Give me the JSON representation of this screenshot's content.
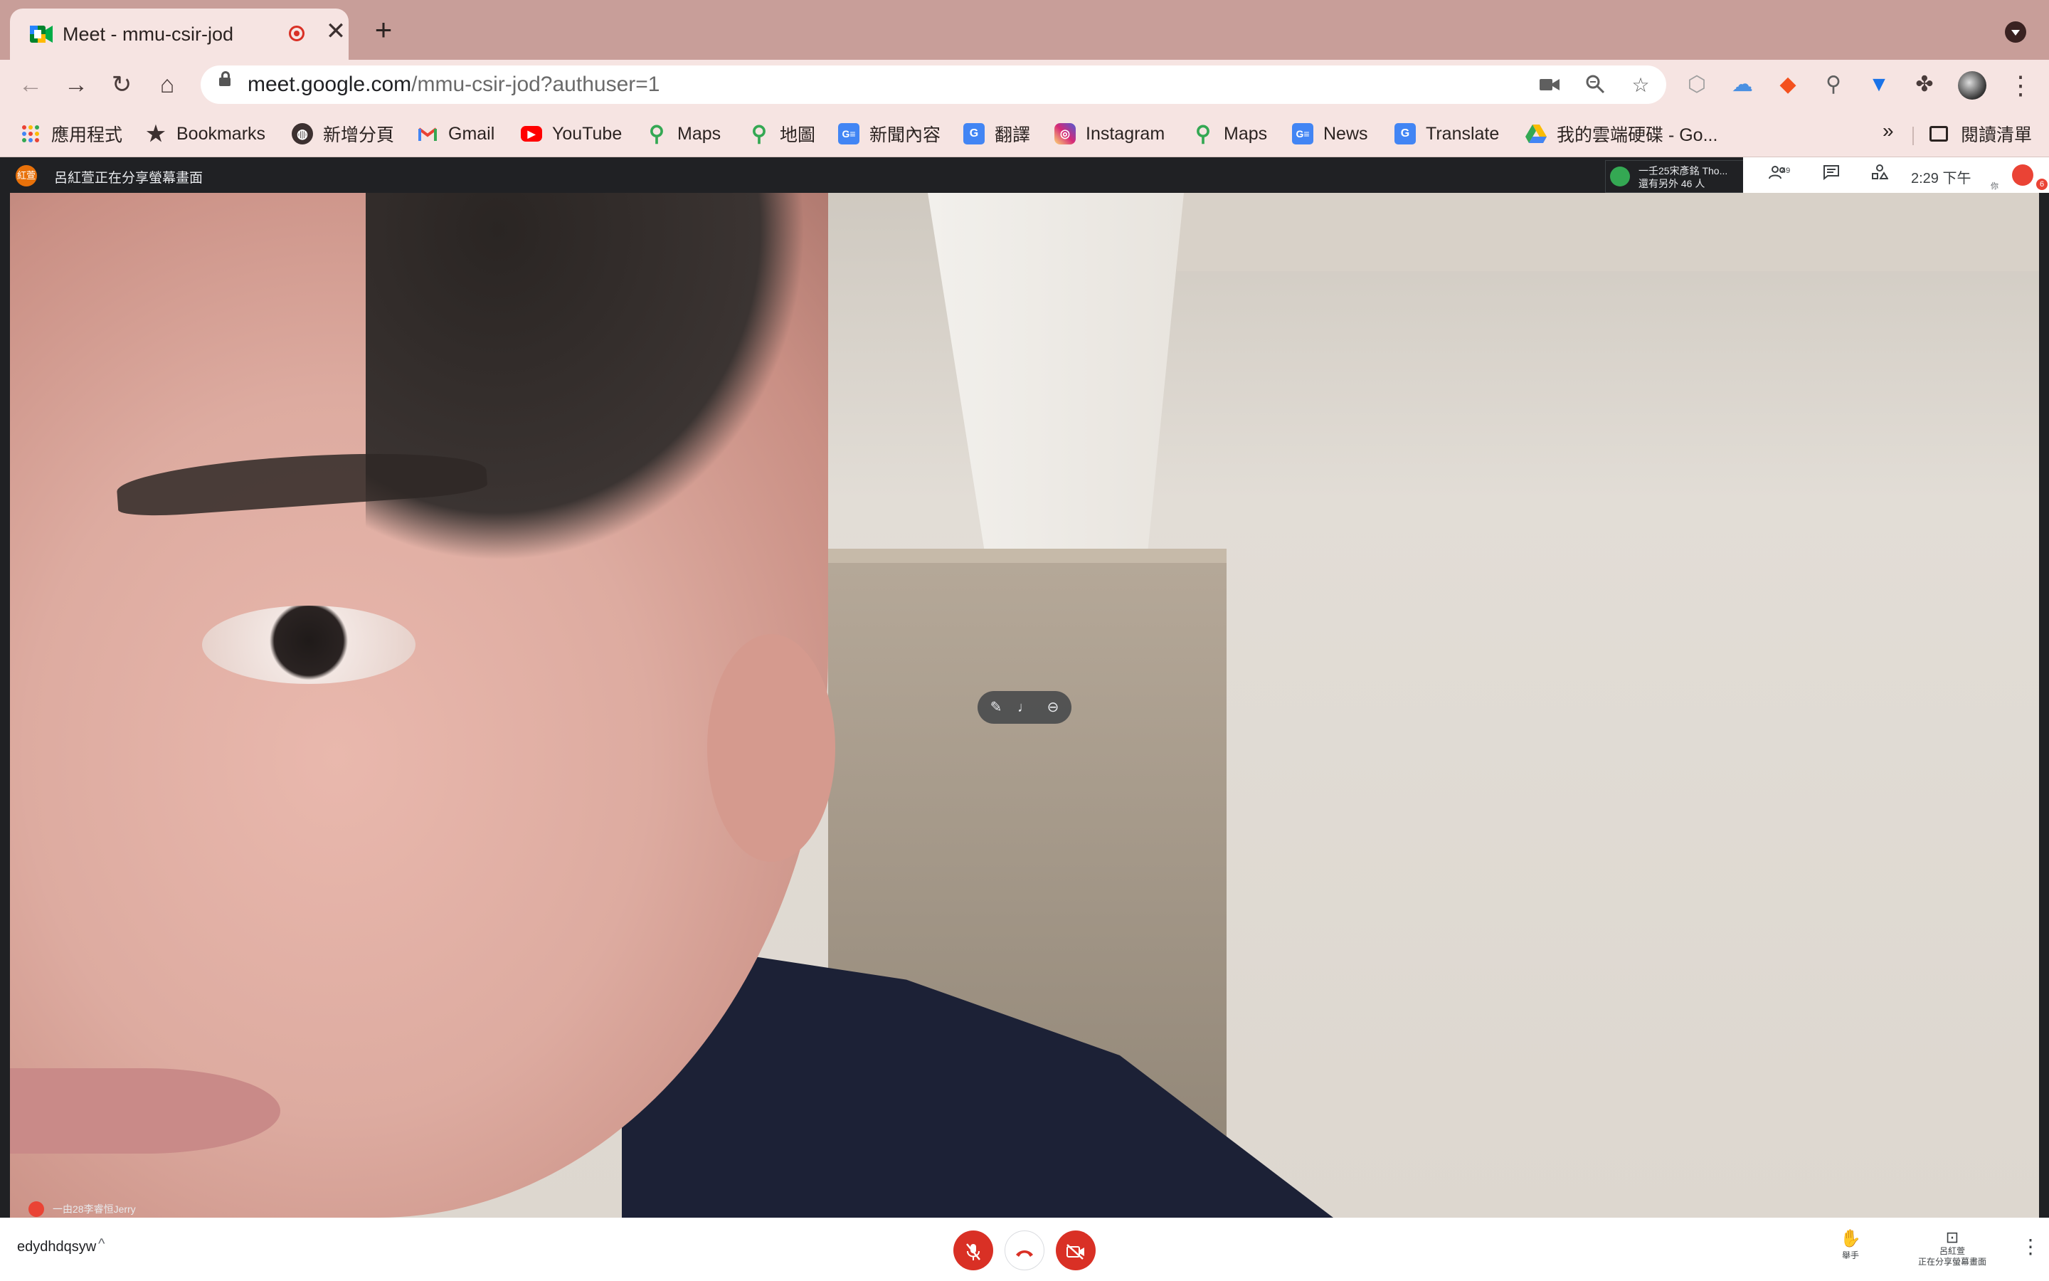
{
  "tab": {
    "title": "Meet - mmu-csir-jod",
    "close": "✕",
    "new_tab": "+"
  },
  "toolbar": {
    "back": "←",
    "forward": "→",
    "reload": "↻",
    "home": "⌂",
    "url_host": "meet.google.com",
    "url_path": "/mmu-csir-jod?authuser=1",
    "menu": "⋮"
  },
  "bookmarks": {
    "items": [
      {
        "label": "應用程式",
        "icon": "apps-grid-icon"
      },
      {
        "label": "Bookmarks",
        "icon": "star-icon"
      },
      {
        "label": "新增分頁",
        "icon": "globe-icon"
      },
      {
        "label": "Gmail",
        "icon": "gmail-icon"
      },
      {
        "label": "YouTube",
        "icon": "youtube-icon"
      },
      {
        "label": "Maps",
        "icon": "maps-pin-icon"
      },
      {
        "label": "地圖",
        "icon": "maps-pin-icon"
      },
      {
        "label": "新聞內容",
        "icon": "google-news-icon"
      },
      {
        "label": "翻譯",
        "icon": "translate-icon"
      },
      {
        "label": "Instagram",
        "icon": "instagram-icon"
      },
      {
        "label": "Maps",
        "icon": "maps-pin-icon"
      },
      {
        "label": "News",
        "icon": "google-news-icon"
      },
      {
        "label": "Translate",
        "icon": "translate-icon"
      },
      {
        "label": "我的雲端硬碟 - Go...",
        "icon": "google-drive-icon"
      }
    ],
    "more": "»",
    "reading_list": "閱讀清單"
  },
  "meet": {
    "presenter_avatar": "紅萱",
    "sharing_text": "呂紅萱正在分享螢幕畫面",
    "participant_chip_line1": "一壬25宋彥銘 Tho...",
    "participant_chip_line2": "還有另外 46 人",
    "participant_count": "49",
    "clock": "2:29 下午",
    "self_label": "你",
    "self_badge": "6",
    "tile_name": "一由28李睿恒Jerry",
    "meeting_code": "edydhdqsyw",
    "meeting_chevron": "^",
    "raise_hand_label": "舉手",
    "presenting_name": "呂紅萱",
    "presenting_label": "正在分享螢幕畫面",
    "more": "⋮"
  },
  "colors": {
    "tab_strip": "#c89e99",
    "toolbar": "#f6e4e2",
    "meet_red": "#d93025",
    "meet_dark": "#202124"
  }
}
